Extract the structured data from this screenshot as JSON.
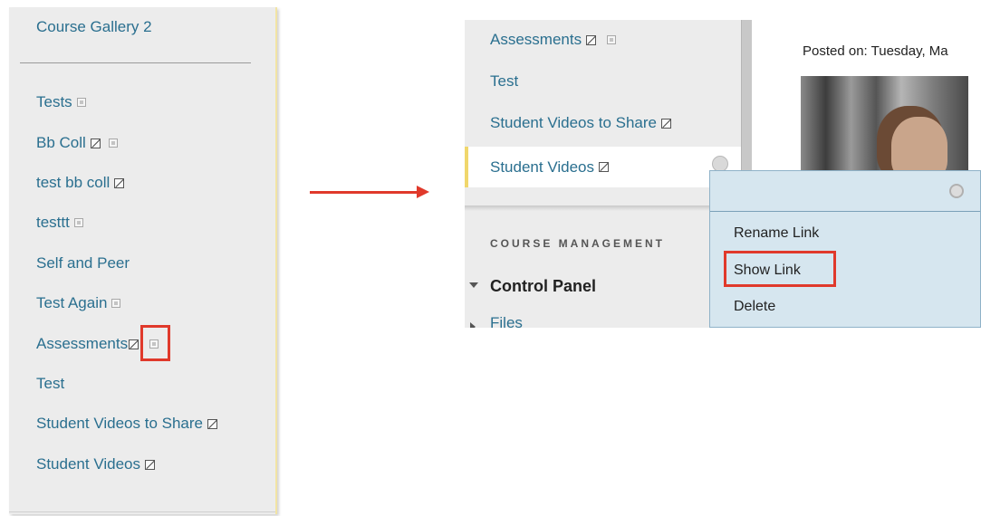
{
  "left_panel": {
    "items": [
      {
        "label": "Course Gallery 2"
      },
      {
        "label": "Tests"
      },
      {
        "label": "Bb Coll"
      },
      {
        "label": "test bb coll"
      },
      {
        "label": "testtt"
      },
      {
        "label": "Self and Peer"
      },
      {
        "label": "Test Again"
      },
      {
        "label": "Assessments"
      },
      {
        "label": "Test"
      },
      {
        "label": "Student Videos to Share"
      },
      {
        "label": "Student Videos"
      }
    ]
  },
  "right_panel": {
    "nav_items": [
      {
        "label": "Assessments"
      },
      {
        "label": "Test"
      },
      {
        "label": "Student Videos to Share"
      },
      {
        "label": "Student Videos"
      }
    ],
    "section_heading": "COURSE MANAGEMENT",
    "control_panel": "Control Panel",
    "files": "Files",
    "posted_on": "Posted on: Tuesday, Ma",
    "context_menu": {
      "items": [
        {
          "label": "Rename Link"
        },
        {
          "label": "Show Link"
        },
        {
          "label": "Delete"
        }
      ]
    }
  },
  "colors": {
    "link": "#2a6f8f",
    "highlight": "#e0392b",
    "menu_bg": "#d6e6ef"
  }
}
